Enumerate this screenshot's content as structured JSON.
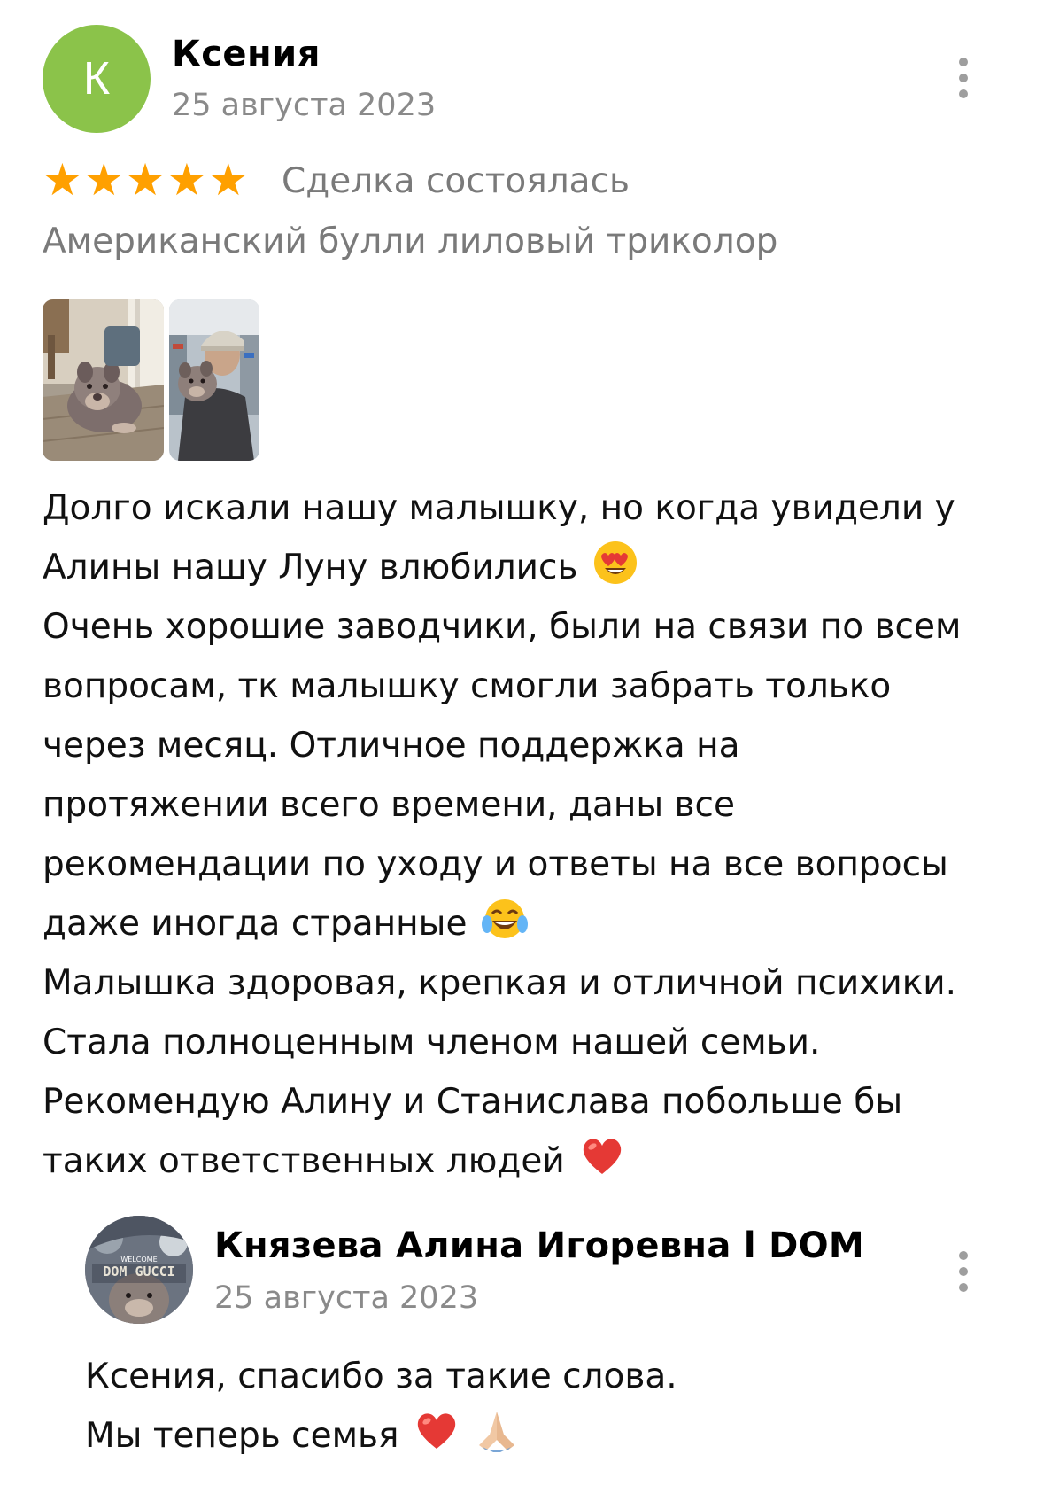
{
  "review": {
    "author": {
      "initial": "К",
      "name": "Ксения",
      "avatar_color": "#8bc34a"
    },
    "date": "25 августа 2023",
    "rating": 5,
    "rating_stars": [
      "★",
      "★",
      "★",
      "★",
      "★"
    ],
    "deal_status": "Сделка состоялась",
    "item_title": "Американский булли лиловый триколор",
    "photos": [
      {
        "icon": "dog-photo"
      },
      {
        "icon": "man-with-dog-photo"
      }
    ],
    "text_lines": [
      "Долго искали нашу малышку, но когда увидели у",
      "Алины нашу Луну влюбились",
      "Очень хорошие заводчики, были на связи по всем",
      "вопросам, тк малышку смогли забрать только",
      "через месяц. Отличное поддержка на",
      "протяжении всего времени, даны все",
      "рекомендации по уходу и ответы на все вопросы",
      "даже иногда странные",
      "Малышка здоровая, крепкая и отличной психики.",
      "Стала полноценным членом нашей семьи.",
      "Рекомендую Алину и Станислава побольше бы",
      "таких ответственных людей"
    ],
    "emojis": {
      "line2": "heart-eyes-emoji",
      "line8": "tears-of-joy-emoji",
      "line12": "red-heart-emoji"
    }
  },
  "reply": {
    "author": {
      "name": "Князева Алина Игоревна l DOM",
      "avatar_text_top": "WELCOME",
      "avatar_text": "DOM GUCCI"
    },
    "date": "25 августа 2023",
    "text_lines": [
      "Ксения, спасибо за такие слова.",
      "Мы теперь семья"
    ],
    "emojis": [
      "red-heart-emoji",
      "folded-hands-emoji"
    ]
  },
  "colors": {
    "star": "#ffa000",
    "muted_text": "#7a7a7a",
    "date_text": "#8a8a8a"
  }
}
